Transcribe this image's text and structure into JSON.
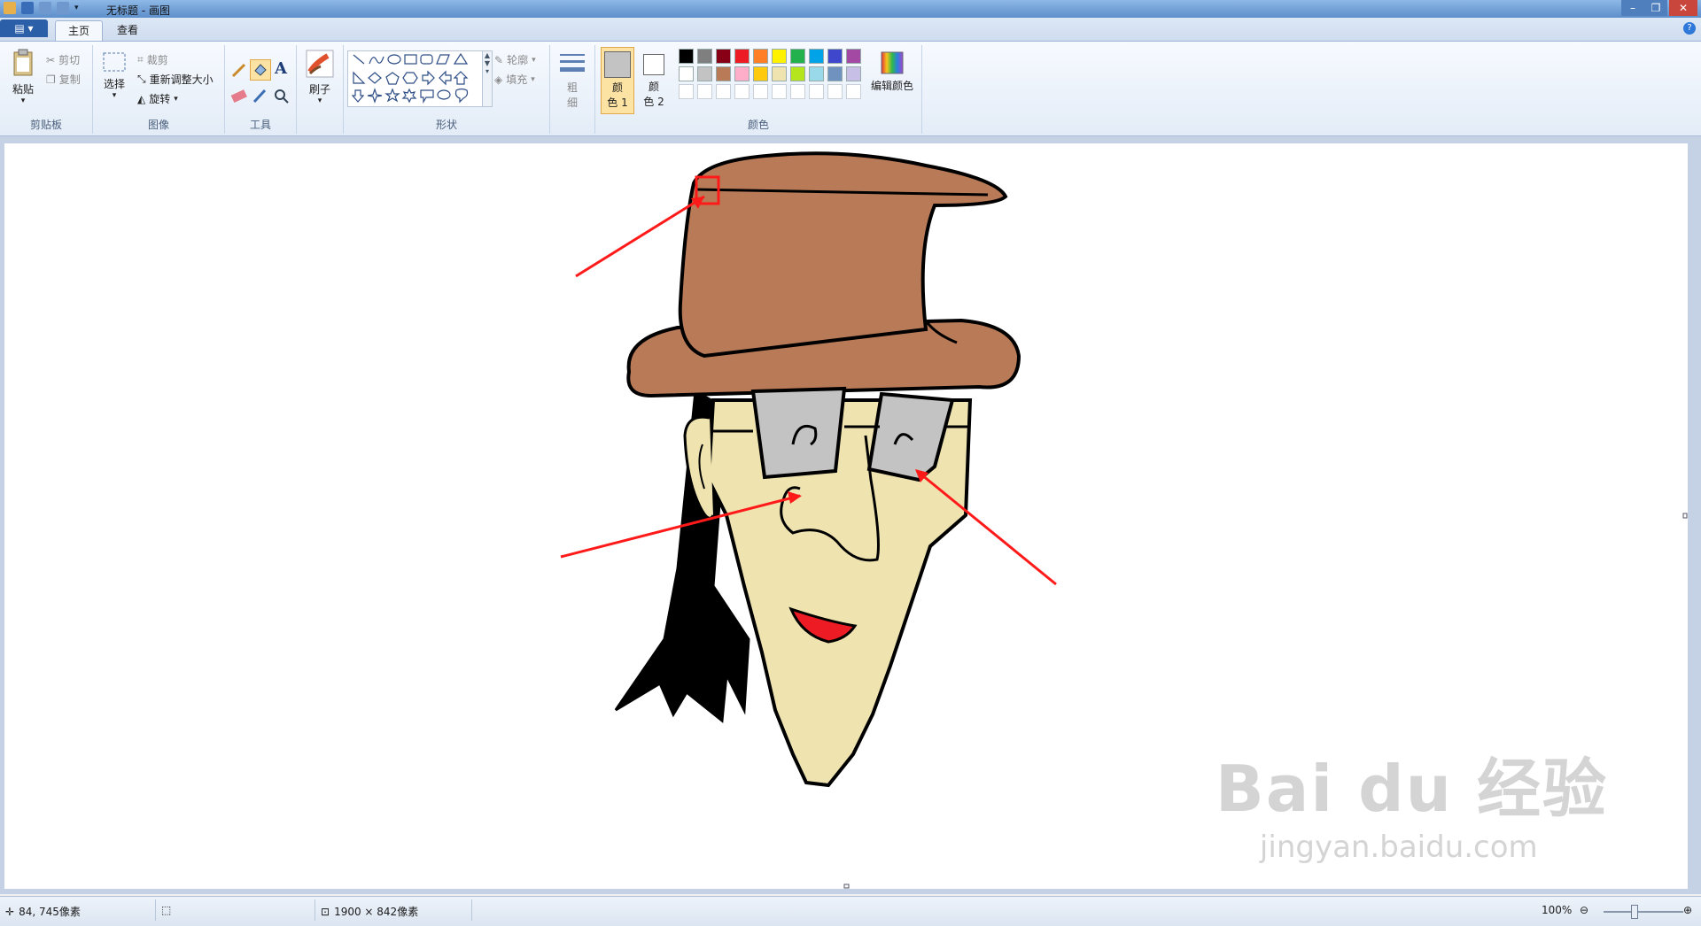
{
  "window": {
    "title": "无标题 - 画图"
  },
  "tabs": [
    {
      "label": "主页",
      "active": true
    },
    {
      "label": "查看",
      "active": false
    }
  ],
  "ribbon": {
    "clipboard": {
      "group_label": "剪贴板",
      "paste": "粘贴",
      "cut": "剪切",
      "copy": "复制"
    },
    "image": {
      "group_label": "图像",
      "select": "选择",
      "crop": "裁剪",
      "resize": "重新调整大小",
      "rotate": "旋转"
    },
    "tools": {
      "group_label": "工具",
      "text_tool_glyph": "A"
    },
    "brush": {
      "label": "刷子"
    },
    "shapes": {
      "group_label": "形状",
      "outline": "轮廓",
      "fill": "填充"
    },
    "size": {
      "label_line1": "粗",
      "label_line2": "细"
    },
    "colors": {
      "group_label": "颜色",
      "color1_label_line1": "颜",
      "color1_label_line2": "色 1",
      "color2_label_line1": "颜",
      "color2_label_line2": "色 2",
      "edit_colors": "编辑颜色",
      "color1_value": "#c3c3c3",
      "color2_value": "#ffffff",
      "palette_row1": [
        "#000000",
        "#7f7f7f",
        "#880015",
        "#ed1c24",
        "#ff7f27",
        "#fff200",
        "#22b14c",
        "#00a2e8",
        "#3f48cc",
        "#a349a4"
      ],
      "palette_row2": [
        "#ffffff",
        "#c3c3c3",
        "#b97a57",
        "#ffaec9",
        "#ffc90e",
        "#efe4b0",
        "#b5e61d",
        "#99d9ea",
        "#7092be",
        "#c8bfe7"
      ]
    }
  },
  "canvas": {
    "hat_color": "#b97a57",
    "face_color": "#efe4b0",
    "lens_color": "#c3c3c3",
    "hair_color": "#000000",
    "mouth_color": "#ed1c24",
    "arrow_color": "#ff1a1a"
  },
  "watermark": {
    "big": "Bai  du 经验",
    "small": "jingyan.baidu.com"
  },
  "statusbar": {
    "cursor_pos": "84, 745像素",
    "canvas_size": "1900 × 842像素",
    "zoom": "100%"
  }
}
